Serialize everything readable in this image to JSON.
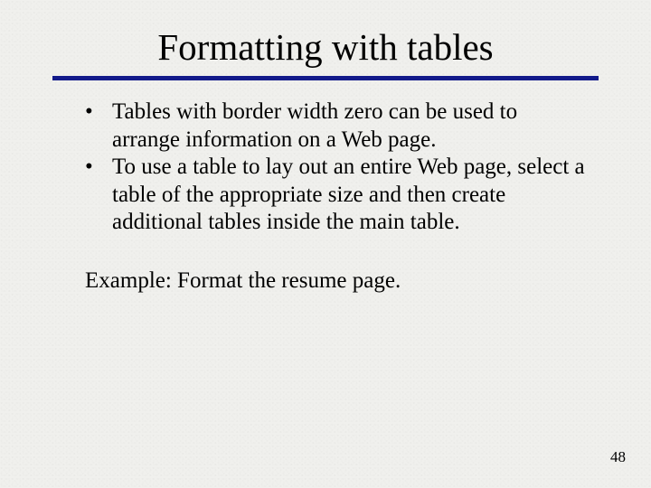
{
  "title": "Formatting with tables",
  "bullets": [
    "Tables with border width zero can be used to arrange information on a Web page.",
    "To use a table to lay out an entire Web page, select a table of the appropriate size and then create additional tables inside the main table."
  ],
  "example": "Example: Format the resume page.",
  "page_number": "48"
}
